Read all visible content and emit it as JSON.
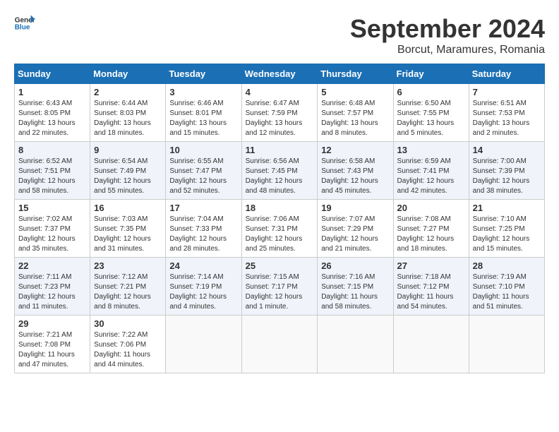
{
  "header": {
    "logo_general": "General",
    "logo_blue": "Blue",
    "title": "September 2024",
    "subtitle": "Borcut, Maramures, Romania"
  },
  "days_of_week": [
    "Sunday",
    "Monday",
    "Tuesday",
    "Wednesday",
    "Thursday",
    "Friday",
    "Saturday"
  ],
  "weeks": [
    [
      {
        "day": "1",
        "info": "Sunrise: 6:43 AM\nSunset: 8:05 PM\nDaylight: 13 hours and 22 minutes."
      },
      {
        "day": "2",
        "info": "Sunrise: 6:44 AM\nSunset: 8:03 PM\nDaylight: 13 hours and 18 minutes."
      },
      {
        "day": "3",
        "info": "Sunrise: 6:46 AM\nSunset: 8:01 PM\nDaylight: 13 hours and 15 minutes."
      },
      {
        "day": "4",
        "info": "Sunrise: 6:47 AM\nSunset: 7:59 PM\nDaylight: 13 hours and 12 minutes."
      },
      {
        "day": "5",
        "info": "Sunrise: 6:48 AM\nSunset: 7:57 PM\nDaylight: 13 hours and 8 minutes."
      },
      {
        "day": "6",
        "info": "Sunrise: 6:50 AM\nSunset: 7:55 PM\nDaylight: 13 hours and 5 minutes."
      },
      {
        "day": "7",
        "info": "Sunrise: 6:51 AM\nSunset: 7:53 PM\nDaylight: 13 hours and 2 minutes."
      }
    ],
    [
      {
        "day": "8",
        "info": "Sunrise: 6:52 AM\nSunset: 7:51 PM\nDaylight: 12 hours and 58 minutes."
      },
      {
        "day": "9",
        "info": "Sunrise: 6:54 AM\nSunset: 7:49 PM\nDaylight: 12 hours and 55 minutes."
      },
      {
        "day": "10",
        "info": "Sunrise: 6:55 AM\nSunset: 7:47 PM\nDaylight: 12 hours and 52 minutes."
      },
      {
        "day": "11",
        "info": "Sunrise: 6:56 AM\nSunset: 7:45 PM\nDaylight: 12 hours and 48 minutes."
      },
      {
        "day": "12",
        "info": "Sunrise: 6:58 AM\nSunset: 7:43 PM\nDaylight: 12 hours and 45 minutes."
      },
      {
        "day": "13",
        "info": "Sunrise: 6:59 AM\nSunset: 7:41 PM\nDaylight: 12 hours and 42 minutes."
      },
      {
        "day": "14",
        "info": "Sunrise: 7:00 AM\nSunset: 7:39 PM\nDaylight: 12 hours and 38 minutes."
      }
    ],
    [
      {
        "day": "15",
        "info": "Sunrise: 7:02 AM\nSunset: 7:37 PM\nDaylight: 12 hours and 35 minutes."
      },
      {
        "day": "16",
        "info": "Sunrise: 7:03 AM\nSunset: 7:35 PM\nDaylight: 12 hours and 31 minutes."
      },
      {
        "day": "17",
        "info": "Sunrise: 7:04 AM\nSunset: 7:33 PM\nDaylight: 12 hours and 28 minutes."
      },
      {
        "day": "18",
        "info": "Sunrise: 7:06 AM\nSunset: 7:31 PM\nDaylight: 12 hours and 25 minutes."
      },
      {
        "day": "19",
        "info": "Sunrise: 7:07 AM\nSunset: 7:29 PM\nDaylight: 12 hours and 21 minutes."
      },
      {
        "day": "20",
        "info": "Sunrise: 7:08 AM\nSunset: 7:27 PM\nDaylight: 12 hours and 18 minutes."
      },
      {
        "day": "21",
        "info": "Sunrise: 7:10 AM\nSunset: 7:25 PM\nDaylight: 12 hours and 15 minutes."
      }
    ],
    [
      {
        "day": "22",
        "info": "Sunrise: 7:11 AM\nSunset: 7:23 PM\nDaylight: 12 hours and 11 minutes."
      },
      {
        "day": "23",
        "info": "Sunrise: 7:12 AM\nSunset: 7:21 PM\nDaylight: 12 hours and 8 minutes."
      },
      {
        "day": "24",
        "info": "Sunrise: 7:14 AM\nSunset: 7:19 PM\nDaylight: 12 hours and 4 minutes."
      },
      {
        "day": "25",
        "info": "Sunrise: 7:15 AM\nSunset: 7:17 PM\nDaylight: 12 hours and 1 minute."
      },
      {
        "day": "26",
        "info": "Sunrise: 7:16 AM\nSunset: 7:15 PM\nDaylight: 11 hours and 58 minutes."
      },
      {
        "day": "27",
        "info": "Sunrise: 7:18 AM\nSunset: 7:12 PM\nDaylight: 11 hours and 54 minutes."
      },
      {
        "day": "28",
        "info": "Sunrise: 7:19 AM\nSunset: 7:10 PM\nDaylight: 11 hours and 51 minutes."
      }
    ],
    [
      {
        "day": "29",
        "info": "Sunrise: 7:21 AM\nSunset: 7:08 PM\nDaylight: 11 hours and 47 minutes."
      },
      {
        "day": "30",
        "info": "Sunrise: 7:22 AM\nSunset: 7:06 PM\nDaylight: 11 hours and 44 minutes."
      },
      {
        "day": "",
        "info": ""
      },
      {
        "day": "",
        "info": ""
      },
      {
        "day": "",
        "info": ""
      },
      {
        "day": "",
        "info": ""
      },
      {
        "day": "",
        "info": ""
      }
    ]
  ]
}
